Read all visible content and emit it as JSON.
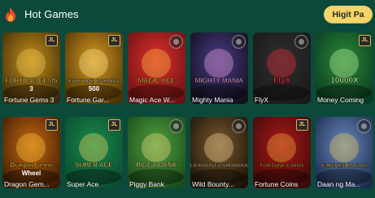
{
  "header": {
    "title": "Hot Games",
    "more_label": "Higit Pa"
  },
  "colors": {
    "background": "#0b4a3b",
    "accent": "#f5d46b"
  },
  "games": [
    {
      "name": "Fortune Gems 3",
      "art_text": "FORTUNE GEMS",
      "art_sub": "3",
      "icon": "badge-jl-icon"
    },
    {
      "name": "Fortune Gar...",
      "art_text": "FORTUNE GARUDA",
      "art_sub": "500",
      "icon": "badge-jl-icon"
    },
    {
      "name": "Magic Ace W...",
      "art_text": "MAGIC ACE",
      "art_sub": "",
      "icon": "favorite-icon"
    },
    {
      "name": "Mighty Mania",
      "art_text": "MIGHTY MANIA",
      "art_sub": "",
      "icon": "favorite-icon"
    },
    {
      "name": "FlyX",
      "art_text": "FlyX",
      "art_sub": "",
      "icon": "favorite-icon"
    },
    {
      "name": "Money Coming",
      "art_text": "10000X",
      "art_sub": "",
      "icon": "badge-jl-icon"
    },
    {
      "name": "Dragon Gem...",
      "art_text": "Dragon Gems",
      "art_sub": "Wheel",
      "icon": "badge-jl-icon"
    },
    {
      "name": "Super Ace",
      "art_text": "SUPER ACE",
      "art_sub": "",
      "icon": "badge-jl-icon"
    },
    {
      "name": "Piggy Bank",
      "art_text": "PIGGY BANK",
      "art_sub": "",
      "icon": "favorite-icon"
    },
    {
      "name": "Wild Bounty...",
      "art_text": "WILD BOUNTY SHOWDOWN",
      "art_sub": "",
      "icon": "favorite-icon"
    },
    {
      "name": "Fortune Coins",
      "art_text": "FORTUNE COINS",
      "art_sub": "",
      "icon": "badge-jl-icon"
    },
    {
      "name": "Daan ng Ma...",
      "art_text": "CHICKEN ROAD 2",
      "art_sub": "",
      "icon": "favorite-icon"
    }
  ],
  "badge_text": "JL"
}
